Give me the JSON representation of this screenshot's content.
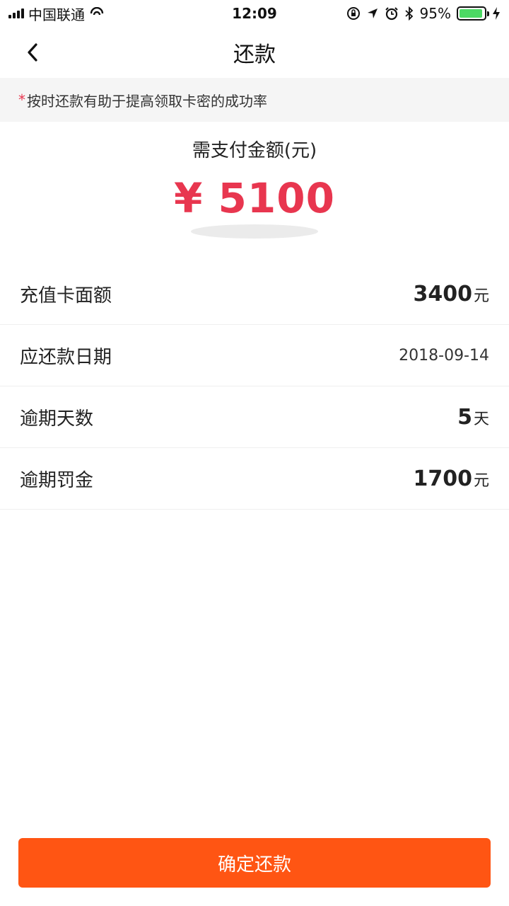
{
  "status_bar": {
    "carrier": "中国联通",
    "time": "12:09",
    "battery": "95%",
    "battery_level": 0.95
  },
  "nav": {
    "title": "还款"
  },
  "tip": {
    "star": "*",
    "text": "按时还款有助于提高领取卡密的成功率"
  },
  "amount": {
    "label": "需支付金额(元)",
    "value": "¥ 5100"
  },
  "details": [
    {
      "label": "充值卡面额",
      "value": "3400",
      "unit": "元"
    },
    {
      "label": "应还款日期",
      "value": "2018-09-14"
    },
    {
      "label": "逾期天数",
      "value": "5",
      "unit": "天"
    },
    {
      "label": "逾期罚金",
      "value": "1700",
      "unit": "元"
    }
  ],
  "button": {
    "label": "确定还款"
  },
  "colors": {
    "accent_red": "#e8364f",
    "button_orange": "#ff5513",
    "tip_bg": "#f5f5f5",
    "battery_green": "#4cd964"
  }
}
